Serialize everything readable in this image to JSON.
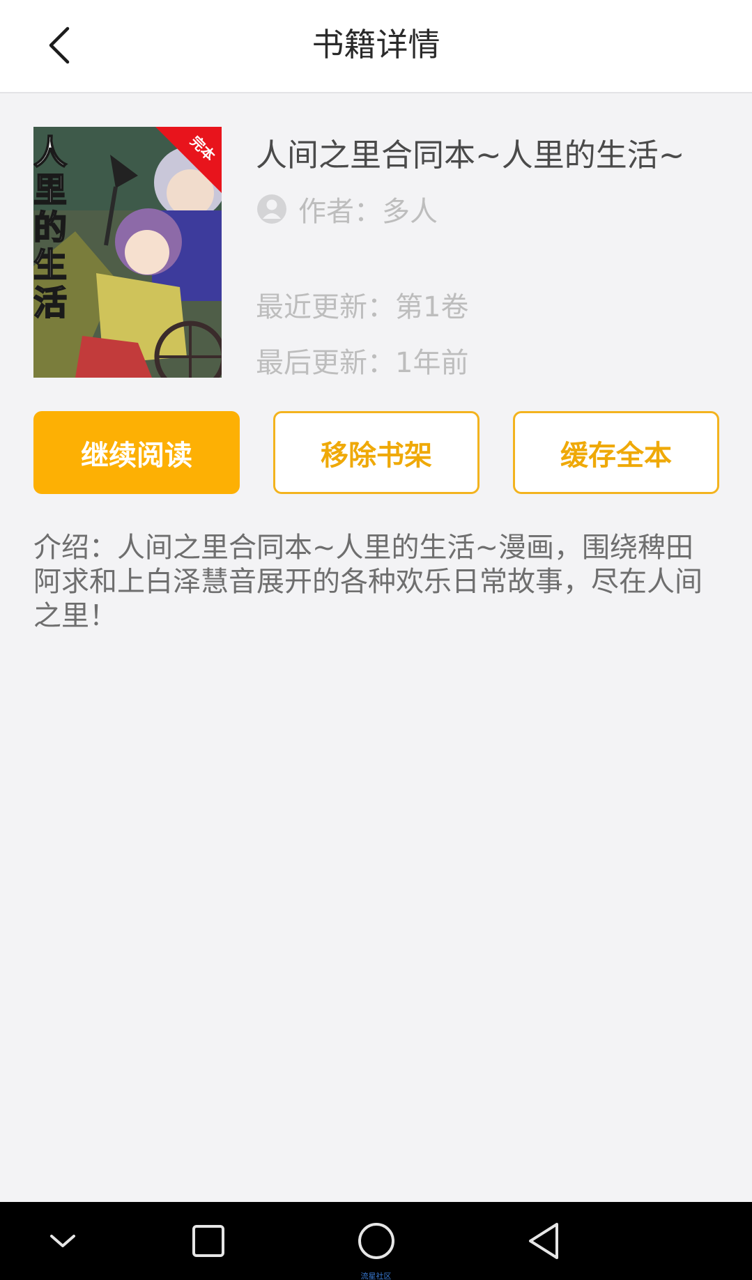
{
  "header": {
    "title": "书籍详情",
    "back_icon": "chevron-left-icon"
  },
  "book": {
    "title": "人间之里合同本~人里的生活~",
    "cover_title": "人里的生活",
    "cover_badge": "完本",
    "author_label": "作者：",
    "author": "多人",
    "recent_update_label": "最近更新：",
    "recent_update": "第1卷",
    "last_update_label": "最后更新：",
    "last_update": "1年前",
    "intro": "介绍：人间之里合同本~人里的生活~漫画，围绕稗田阿求和上白泽慧音展开的各种欢乐日常故事，尽在人间之里！"
  },
  "actions": {
    "continue_label": "继续阅读",
    "remove_label": "移除书架",
    "cache_label": "缓存全本"
  },
  "navbar": {
    "icons": [
      "chevron-down-icon",
      "square-icon",
      "circle-icon",
      "triangle-back-icon"
    ],
    "caption": "流星社区"
  },
  "colors": {
    "accent": "#fdb004",
    "outline": "#f3b31e",
    "badge": "#e8141c",
    "background": "#f3f3f5"
  }
}
